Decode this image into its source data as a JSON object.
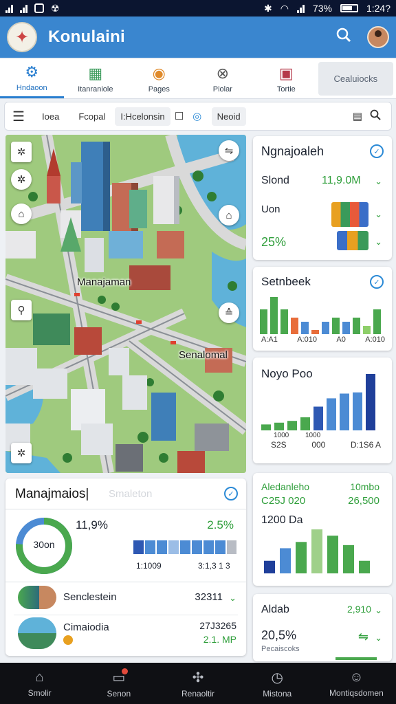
{
  "statusbar": {
    "battery": "73%",
    "time": "1:24?"
  },
  "appbar": {
    "title": "Konulaini",
    "logo_icon": "compass-logo",
    "search_icon": "search-icon"
  },
  "tabs": [
    {
      "label": "Hndaoon",
      "icon": "gear-icon",
      "active": true
    },
    {
      "label": "Itanraniole",
      "icon": "book-icon"
    },
    {
      "label": "Pages",
      "icon": "globe-icon"
    },
    {
      "label": "Piolar",
      "icon": "ball-icon"
    },
    {
      "label": "Tortie",
      "icon": "tv-icon"
    }
  ],
  "tab_category": "Cealuiocks",
  "toolbar": {
    "item1": "Ioea",
    "item2": "Fcopal",
    "item3": "I:Hcelonsin",
    "item4": "Neoid"
  },
  "map": {
    "label1": "Manajaman",
    "label2": "Senalomal"
  },
  "card_top": {
    "title": "Ngnajoaleh",
    "row1_label": "Slond",
    "row1_value": "11,9.0M",
    "row2_label": "Uon",
    "row2_value": "25%"
  },
  "card_bar1": {
    "title": "Setnbeek",
    "labels": [
      "A:A1",
      "A:010",
      "A0",
      "A:010"
    ],
    "values": [
      6,
      9,
      6,
      4,
      3,
      1,
      3,
      4,
      3,
      4,
      2,
      6
    ],
    "colors": [
      "#4aa84e",
      "#4aa84e",
      "#4aa84e",
      "#e86d3a",
      "#4c8bd4",
      "#e86d3a",
      "#4c8bd4",
      "#4aa84e",
      "#4c8bd4",
      "#4aa84e",
      "#8ecf6a",
      "#4aa84e"
    ]
  },
  "card_bar2": {
    "title": "Noyo Poo",
    "labels_row1": [
      "1000",
      "1000"
    ],
    "labels_row2": [
      "S2S",
      "000",
      "D:1S6 A"
    ],
    "values": [
      1,
      1.3,
      1.6,
      2.2,
      4,
      5.4,
      6.2,
      6.4,
      9.5
    ],
    "colors": [
      "#4aa84e",
      "#4aa84e",
      "#4aa84e",
      "#4aa84e",
      "#2e58b3",
      "#4c8bd4",
      "#4c8bd4",
      "#4c8bd4",
      "#1f3f9a"
    ]
  },
  "card_mid_right": {
    "label_left": "Aledanleho",
    "label_right": "10mbo",
    "value_left": "C25J 020",
    "value_right": "26,500",
    "subtitle": "1200 Da",
    "values": [
      2,
      4,
      5,
      7,
      6,
      4.5,
      2
    ],
    "colors": [
      "#1f3f9a",
      "#4c8bd4",
      "#4aa84e",
      "#9fd08a",
      "#4aa84e",
      "#4aa84e",
      "#4aa84e"
    ]
  },
  "card_bottom_right": {
    "title": "Aldab",
    "value_right": "2,910",
    "percent": "20,5%",
    "sub": "Pecaiscoks"
  },
  "summary": {
    "title": "Manajmaios|",
    "placeholder": "Smaleton",
    "donut_center": "30on",
    "donut_fraction": 0.76,
    "percent_left": "11,9%",
    "percent_right": "2.5%",
    "mini_bars": [
      6,
      6,
      6,
      6,
      6,
      6,
      6,
      6,
      6
    ],
    "mini_colors": [
      "#2e58b3",
      "#4c8bd4",
      "#4c8bd4",
      "#9bbde6",
      "#4c8bd4",
      "#4c8bd4",
      "#4c8bd4",
      "#4c8bd4",
      "#b8bcc4"
    ],
    "axis_left": "1:1009",
    "axis_right": "3:1,3 1 3",
    "rows": [
      {
        "label": "Senclestein",
        "value": "32311",
        "sub": ""
      },
      {
        "label": "Cimaiodia",
        "value": "27J3265",
        "sub": "2.1. MP"
      }
    ]
  },
  "bottomnav": [
    {
      "label": "Smolir",
      "icon": "home-icon"
    },
    {
      "label": "Senon",
      "icon": "chat-icon",
      "badge": true
    },
    {
      "label": "Renaoltir",
      "icon": "puzzle-icon"
    },
    {
      "label": "Mistona",
      "icon": "clock-icon"
    },
    {
      "label": "Montiqsdomen",
      "icon": "person-icon"
    }
  ]
}
